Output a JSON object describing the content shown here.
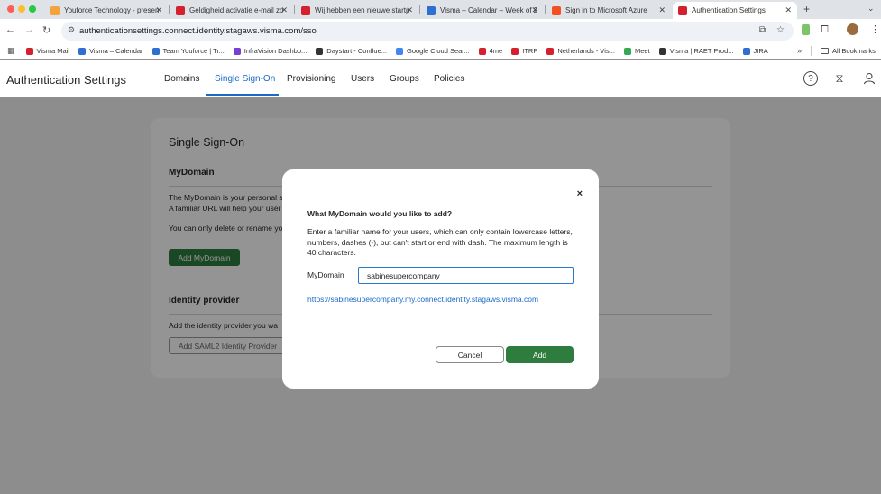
{
  "browser": {
    "tabs": [
      {
        "title": "Youforce Technology - presen",
        "color": "#f2a33a"
      },
      {
        "title": "Geldigheid activatie e-mail zo",
        "color": "#d3212f"
      },
      {
        "title": "Wij hebben een nieuwe startp",
        "color": "#d3212f"
      },
      {
        "title": "Visma – Calendar – Week of 2",
        "color": "#2f6fd1"
      },
      {
        "title": "Sign in to Microsoft Azure",
        "color": "#f25022"
      },
      {
        "title": "Authentication Settings",
        "color": "#d3212f"
      }
    ],
    "new_tab": "+",
    "url": "authenticationsettings.connect.identity.stagaws.visma.com/sso",
    "bookmarks": [
      {
        "label": "Visma Mail",
        "color": "#d3212f"
      },
      {
        "label": "Visma – Calendar",
        "color": "#2f6fd1"
      },
      {
        "label": "Team Youforce | Tr...",
        "color": "#2f6fd1"
      },
      {
        "label": "InfraVision Dashbo...",
        "color": "#7a3ed1"
      },
      {
        "label": "Daystart - Conflue...",
        "color": "#333333"
      },
      {
        "label": "Google Cloud Sear...",
        "color": "#4285f4"
      },
      {
        "label": "4me",
        "color": "#d3212f"
      },
      {
        "label": "ITRP",
        "color": "#d3212f"
      },
      {
        "label": "Netherlands - Vis...",
        "color": "#d3212f"
      },
      {
        "label": "Meet",
        "color": "#34a853"
      },
      {
        "label": "Visma | RAET Prod...",
        "color": "#333333"
      },
      {
        "label": "JIRA",
        "color": "#2f6fd1"
      }
    ],
    "more_bookmarks": "»",
    "all_bookmarks": "All Bookmarks"
  },
  "app": {
    "title": "Authentication Settings",
    "nav": [
      {
        "label": "Domains"
      },
      {
        "label": "Single Sign-On"
      },
      {
        "label": "Provisioning"
      },
      {
        "label": "Users"
      },
      {
        "label": "Groups"
      },
      {
        "label": "Policies"
      }
    ]
  },
  "page": {
    "heading": "Single Sign-On",
    "mydomain_heading": "MyDomain",
    "mydomain_p1": "The MyDomain is your personal s",
    "mydomain_p2": "A familiar URL will help your user",
    "mydomain_p3": "You can only delete or rename yo",
    "add_mydomain": "Add MyDomain",
    "idp_heading": "Identity provider",
    "idp_p1": "Add the identity provider you wa",
    "add_saml": "Add SAML2 Identity Provider"
  },
  "modal": {
    "close": "×",
    "title": "What MyDomain would you like to add?",
    "description": "Enter a familiar name for your users, which can only contain lowercase letters, numbers, dashes (-), but can't start or end with dash. The maximum length is 40 characters.",
    "field_label": "MyDomain",
    "field_value": "sabinesupercompany",
    "preview_url": "https://sabinesupercompany.my.connect.identity.stagaws.visma.com",
    "cancel": "Cancel",
    "add": "Add"
  },
  "colors": {
    "accent": "#1b6bc6",
    "primary_button": "#2e7d3e"
  }
}
